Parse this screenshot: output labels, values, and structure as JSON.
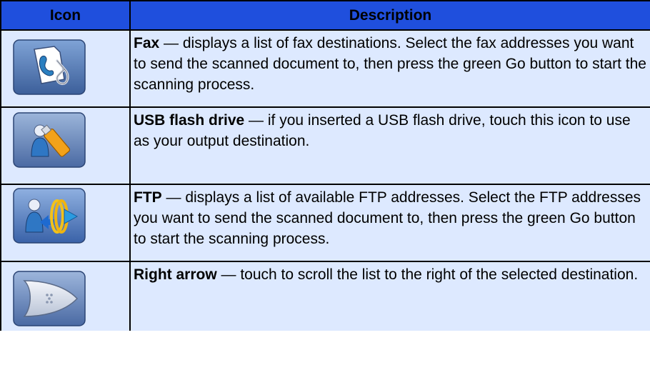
{
  "table": {
    "headers": {
      "icon": "Icon",
      "description": "Description"
    },
    "rows": [
      {
        "icon": "fax-icon",
        "term": "Fax",
        "text": " — displays a list of fax destinations. Select the fax addresses you want to send the scanned document to, then press the green Go button to start the scanning process."
      },
      {
        "icon": "usb-flash-drive-icon",
        "term": "USB flash drive",
        "text": " — if you inserted a USB flash drive, touch this icon to use as your output destination."
      },
      {
        "icon": "ftp-icon",
        "term": "FTP",
        "text": " — displays a list of available FTP addresses. Select the FTP addresses you want to send the scanned document to, then press the green Go button to start the scanning process."
      },
      {
        "icon": "right-arrow-icon",
        "term": "Right arrow",
        "text": " — touch to scroll the list to the right of the selected destination."
      }
    ]
  }
}
